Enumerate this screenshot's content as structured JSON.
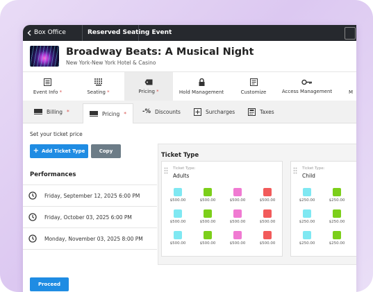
{
  "titlebar": {
    "back_label": "Box Office",
    "event_label": "Reserved Seating Event"
  },
  "event": {
    "title": "Broadway Beats: A Musical Night",
    "venue": "New York-New York Hotel & Casino"
  },
  "main_tabs": [
    {
      "label": "Event Info",
      "required": "*",
      "icon": "list-icon"
    },
    {
      "label": "Seating",
      "required": "*",
      "icon": "seat-grid-icon"
    },
    {
      "label": "Pricing",
      "required": "*",
      "icon": "tag-icon",
      "active": true
    },
    {
      "label": "Hold Management",
      "required": "",
      "icon": "lock-icon"
    },
    {
      "label": "Customize",
      "required": "",
      "icon": "form-icon"
    },
    {
      "label": "Access Management",
      "required": "",
      "icon": "key-icon"
    },
    {
      "label": "M",
      "required": "",
      "icon": "more-icon"
    }
  ],
  "sub_tabs": [
    {
      "label": "Billing",
      "required": "*",
      "icon": "ticket-icon"
    },
    {
      "label": "Pricing",
      "required": "*",
      "icon": "ticket-icon",
      "active": true
    },
    {
      "label": "Discounts",
      "required": "",
      "icon": "percent-icon",
      "icon_text": "-%"
    },
    {
      "label": "Surcharges",
      "required": "",
      "icon": "plus-box-icon"
    },
    {
      "label": "Taxes",
      "required": "",
      "icon": "calculator-icon"
    }
  ],
  "content": {
    "instruction": "Set your ticket price",
    "add_ticket_type_label": "Add Ticket Type",
    "copy_label": "Copy",
    "performances_heading": "Performances",
    "proceed_label": "Proceed"
  },
  "performances": [
    "Friday, September 12, 2025 6:00 PM",
    "Friday, October 03, 2025 6:00 PM",
    "Monday, November 03, 2025 8:00 PM"
  ],
  "ticket_type_panel": {
    "heading": "Ticket Type",
    "field_label": "Ticket Type:",
    "cards": [
      {
        "name": "Adults",
        "rows": [
          [
            "$500.00",
            "$500.00",
            "$500.00",
            "$500.00"
          ],
          [
            "$500.00",
            "$500.00",
            "$500.00",
            "$500.00"
          ],
          [
            "$500.00",
            "$500.00",
            "$500.00",
            "$500.00"
          ]
        ]
      },
      {
        "name": "Child",
        "rows": [
          [
            "$250.00",
            "$250.00"
          ],
          [
            "$250.00",
            "$250.00"
          ],
          [
            "$250.00",
            "$250.00"
          ]
        ]
      }
    ]
  },
  "price_colors": [
    "#7fe8f2",
    "#7ccf1a",
    "#f07ad2",
    "#f25b5b"
  ],
  "colors": {
    "primary": "#1f8ce3",
    "secondary": "#6c7c87",
    "titlebar": "#26292e",
    "required": "#d9534f"
  }
}
